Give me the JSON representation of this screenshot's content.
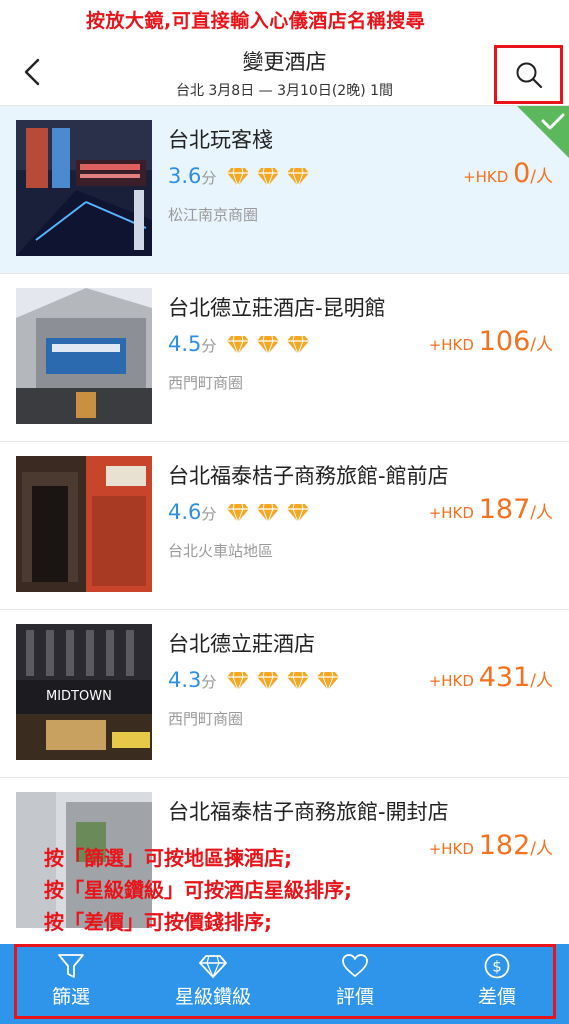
{
  "annotation_top": "按放大鏡,可直接輸入心儀酒店名稱搜尋",
  "header": {
    "title": "變更酒店",
    "subtitle": "台北 3月8日 — 3月10日(2晚) 1間"
  },
  "hotels": [
    {
      "name": "台北玩客棧",
      "rating": "3.6",
      "rating_unit": "分",
      "diamonds": 3,
      "area": "松江南京商圈",
      "price_prefix": "+HKD ",
      "price": "0",
      "price_unit": "/人",
      "selected": true
    },
    {
      "name": "台北德立莊酒店-昆明館",
      "rating": "4.5",
      "rating_unit": "分",
      "diamonds": 3,
      "area": "西門町商圈",
      "price_prefix": "+HKD ",
      "price": "106",
      "price_unit": "/人",
      "selected": false
    },
    {
      "name": "台北福泰桔子商務旅館-館前店",
      "rating": "4.6",
      "rating_unit": "分",
      "diamonds": 3,
      "area": "台北火車站地區",
      "price_prefix": "+HKD ",
      "price": "187",
      "price_unit": "/人",
      "selected": false
    },
    {
      "name": "台北德立莊酒店",
      "rating": "4.3",
      "rating_unit": "分",
      "diamonds": 4,
      "area": "西門町商圈",
      "price_prefix": "+HKD ",
      "price": "431",
      "price_unit": "/人",
      "selected": false
    },
    {
      "name": "台北福泰桔子商務旅館-開封店",
      "rating": "",
      "rating_unit": "",
      "diamonds": 0,
      "area": "",
      "price_prefix": "+HKD ",
      "price": "182",
      "price_unit": "/人",
      "selected": false
    }
  ],
  "annotation_bottom": [
    "按「篩選」可按地區揀酒店;",
    "按「星級鑽級」可按酒店星級排序;",
    "按「差價」可按價錢排序;"
  ],
  "bottom_tabs": [
    {
      "label": "篩選",
      "icon": "filter-icon"
    },
    {
      "label": "星級鑽級",
      "icon": "diamond-icon"
    },
    {
      "label": "評價",
      "icon": "heart-icon"
    },
    {
      "label": "差價",
      "icon": "dollar-icon"
    }
  ],
  "colors": {
    "accent_blue": "#2f95ea",
    "price_orange": "#f4711e",
    "rating_blue": "#2f8fe3",
    "diamond_orange": "#f5a623",
    "annotation_red": "#e8141a",
    "selected_bg": "#e9f5fc",
    "check_green": "#5cb85c"
  }
}
